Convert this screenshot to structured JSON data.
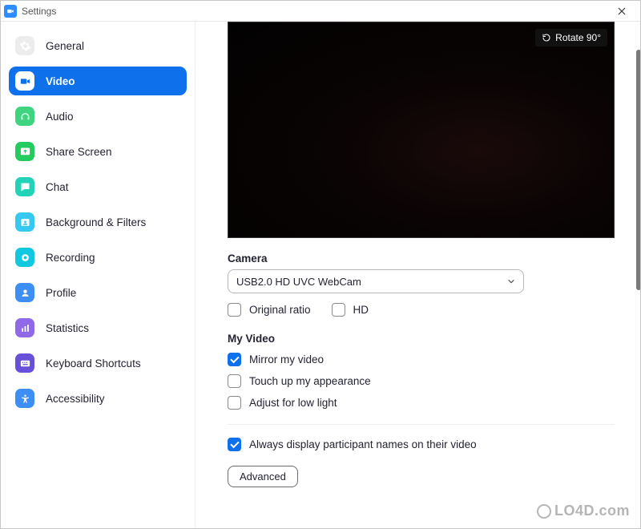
{
  "window": {
    "title": "Settings"
  },
  "sidebar": {
    "items": [
      {
        "label": "General"
      },
      {
        "label": "Video"
      },
      {
        "label": "Audio"
      },
      {
        "label": "Share Screen"
      },
      {
        "label": "Chat"
      },
      {
        "label": "Background & Filters"
      },
      {
        "label": "Recording"
      },
      {
        "label": "Profile"
      },
      {
        "label": "Statistics"
      },
      {
        "label": "Keyboard Shortcuts"
      },
      {
        "label": "Accessibility"
      }
    ]
  },
  "content": {
    "rotate_label": "Rotate 90°",
    "camera_header": "Camera",
    "camera_selected": "USB2.0 HD UVC WebCam",
    "original_ratio": "Original ratio",
    "hd": "HD",
    "myvideo_header": "My Video",
    "mirror": "Mirror my video",
    "touchup": "Touch up my appearance",
    "lowlight": "Adjust for low light",
    "always_names": "Always display participant names on their video",
    "advanced": "Advanced"
  },
  "watermark": {
    "text": "LO4D.com"
  }
}
